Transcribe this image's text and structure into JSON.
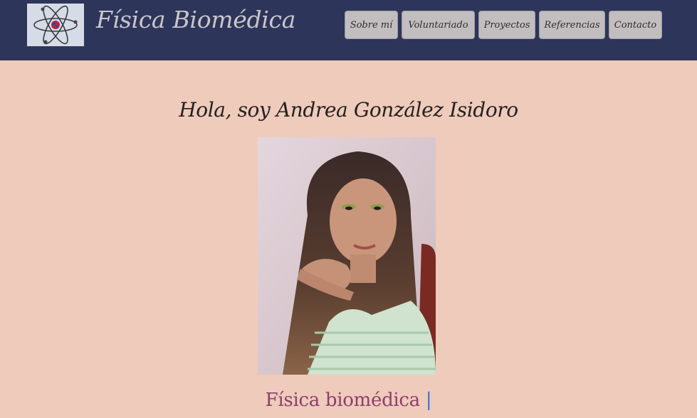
{
  "header": {
    "site_title": "Física Biomédica",
    "logo_icon": "atom-icon"
  },
  "nav": {
    "items": [
      {
        "label": "Sobre mí"
      },
      {
        "label": "Voluntariado"
      },
      {
        "label": "Proyectos"
      },
      {
        "label": "Referencias"
      },
      {
        "label": "Contacto"
      }
    ]
  },
  "main": {
    "greeting": "Hola, soy Andrea González Isidoro",
    "photo_icon": "profile-photo",
    "subtitle": "Física biomédica",
    "subtitle_cursor": "|"
  },
  "colors": {
    "header_bg": "#2e355a",
    "page_bg": "#efcbbb",
    "nav_button_bg": "#c2bebf",
    "subtitle_color": "#8c3f6b",
    "cursor_color": "#3b6fd8"
  }
}
